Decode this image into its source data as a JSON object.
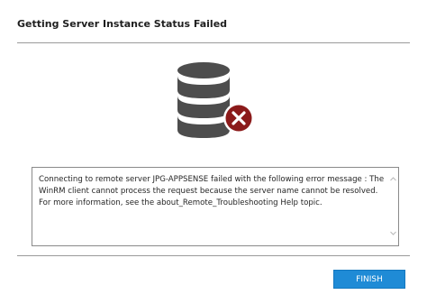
{
  "dialog": {
    "title": "Getting Server Instance Status Failed",
    "icon": "database-error-icon",
    "message": "Connecting to remote server JPG-APPSENSE failed with the following error message : The WinRM client cannot process the request because the server name cannot be resolved. For more information, see the about_Remote_Troubleshooting Help topic.",
    "finish_label": "FINISH"
  },
  "colors": {
    "accent": "#1f8bd6",
    "error": "#8b1a1a",
    "icon_gray": "#4d4d4d"
  }
}
